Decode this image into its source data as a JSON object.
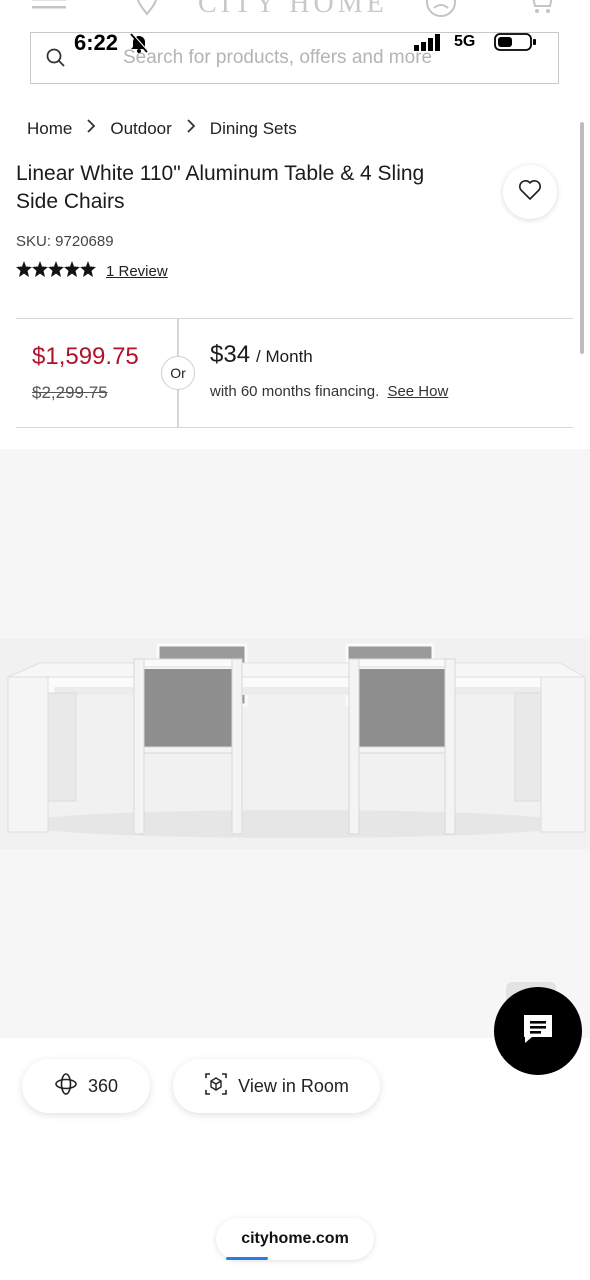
{
  "status_bar": {
    "time": "6:22",
    "network": "5G"
  },
  "header": {
    "logo_text": "CITY HOME"
  },
  "search": {
    "placeholder": "Search for products, offers and more"
  },
  "breadcrumbs": [
    {
      "label": "Home"
    },
    {
      "label": "Outdoor"
    },
    {
      "label": "Dining Sets"
    }
  ],
  "product": {
    "title": "Linear White 110\" Aluminum Table & 4 Sling Side Chairs",
    "sku": "SKU: 9720689",
    "rating_stars": 5,
    "reviews_label": "1 Review"
  },
  "pricing": {
    "sale_price": "$1,599.75",
    "original_price": "$2,299.75",
    "or_label": "Or",
    "monthly_amount": "$34",
    "monthly_unit": "/ Month",
    "financing_text": "with 60 months financing.",
    "financing_link": "See How",
    "sale_color": "#b1122b"
  },
  "actions": {
    "view_360_label": "360",
    "view_in_room_label": "View in Room"
  },
  "browser": {
    "url": "cityhome.com",
    "accent": "#2a7be4"
  },
  "icons": {
    "menu": "menu-icon",
    "location": "location-pin-icon",
    "account": "account-icon",
    "cart": "cart-icon",
    "search": "search-icon",
    "favorite": "heart-icon",
    "view_360": "rotate-360-icon",
    "ar": "cube-ar-icon",
    "chat": "chat-icon"
  }
}
